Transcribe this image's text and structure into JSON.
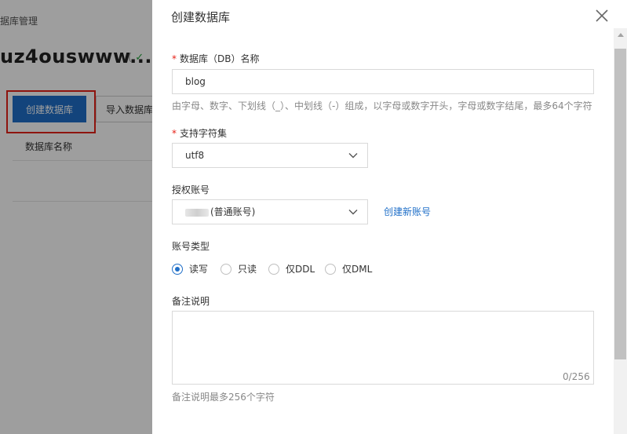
{
  "background": {
    "breadcrumb": "据库管理",
    "instance_title": "uz4ouswww...",
    "status_prefix": "(",
    "status_icon": "✓",
    "create_db_button": "创建数据库",
    "import_db_button": "导入数据库",
    "table_col_db_name": "数据库名称"
  },
  "drawer": {
    "title": "创建数据库",
    "close_icon": "×",
    "db_name": {
      "required_mark": "*",
      "label": "数据库（DB）名称",
      "value": "blog",
      "hint": "由字母、数字、下划线（_）、中划线（-）组成，以字母或数字开头，字母或数字结尾，最多64个字符"
    },
    "charset": {
      "required_mark": "*",
      "label": "支持字符集",
      "value": "utf8"
    },
    "account": {
      "label": "授权账号",
      "value": "(普通账号)",
      "create_link": "创建新账号"
    },
    "account_type": {
      "label": "账号类型",
      "options": [
        "读写",
        "只读",
        "仅DDL",
        "仅DML"
      ],
      "selected": "读写"
    },
    "remark": {
      "label": "备注说明",
      "counter": "0/256",
      "hint": "备注说明最多256个字符"
    }
  },
  "colors": {
    "primary": "#1f6fc8",
    "required": "#e62117",
    "highlight_outline": "#e62117",
    "success": "#22a43b"
  }
}
